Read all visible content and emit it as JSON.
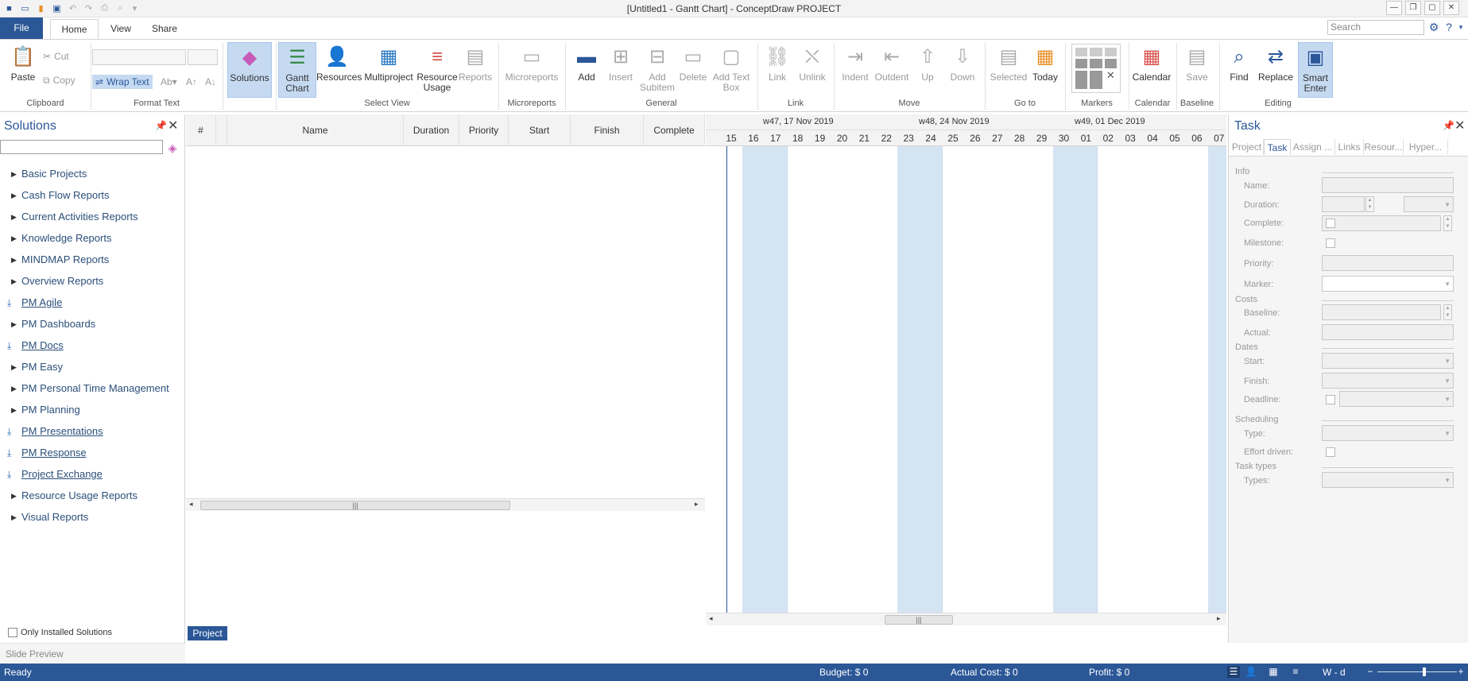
{
  "window": {
    "title": "[Untitled1 - Gantt Chart] - ConceptDraw PROJECT",
    "minimize": "▭",
    "restore": "▭",
    "close": "✕"
  },
  "ribbon_tabs": {
    "file": "File",
    "home": "Home",
    "view": "View",
    "share": "Share"
  },
  "search": {
    "placeholder": "Search"
  },
  "ribbon": {
    "clipboard": {
      "paste": "Paste",
      "cut": "Cut",
      "copy": "Copy",
      "group": "Clipboard"
    },
    "format_text": {
      "wrap_text": "Wrap Text",
      "group": "Format Text"
    },
    "select_view": {
      "solutions": "Solutions",
      "gantt": "Gantt\nChart",
      "resources": "Resources",
      "multiproject": "Multiproject",
      "resource_usage": "Resource\nUsage",
      "reports": "Reports",
      "group": "Select View"
    },
    "microreports": {
      "microreports": "Microreports",
      "group": "Microreports"
    },
    "general": {
      "add": "Add",
      "insert": "Insert",
      "add_subitem": "Add\nSubitem",
      "delete": "Delete",
      "add_text_box": "Add Text\nBox",
      "group": "General"
    },
    "link": {
      "link": "Link",
      "unlink": "Unlink",
      "group": "Link"
    },
    "move": {
      "indent": "Indent",
      "outdent": "Outdent",
      "up": "Up",
      "down": "Down",
      "group": "Move"
    },
    "goto": {
      "selected": "Selected",
      "today": "Today",
      "group": "Go to"
    },
    "markers": {
      "group": "Markers"
    },
    "calendar": {
      "calendar": "Calendar",
      "group": "Calendar"
    },
    "baseline": {
      "save": "Save",
      "group": "Baseline"
    },
    "editing": {
      "find": "Find",
      "replace": "Replace",
      "smart_enter": "Smart\nEnter",
      "group": "Editing"
    }
  },
  "solutions": {
    "title": "Solutions",
    "items": [
      {
        "label": "Basic Projects",
        "installed": false
      },
      {
        "label": "Cash Flow Reports",
        "installed": false
      },
      {
        "label": "Current Activities Reports",
        "installed": false
      },
      {
        "label": "Knowledge Reports",
        "installed": false
      },
      {
        "label": "MINDMAP Reports",
        "installed": false
      },
      {
        "label": "Overview Reports",
        "installed": false
      },
      {
        "label": "PM Agile",
        "installed": true
      },
      {
        "label": "PM Dashboards",
        "installed": false
      },
      {
        "label": "PM Docs",
        "installed": true
      },
      {
        "label": "PM Easy",
        "installed": false
      },
      {
        "label": "PM Personal Time Management",
        "installed": false
      },
      {
        "label": "PM Planning",
        "installed": false
      },
      {
        "label": "PM Presentations",
        "installed": true
      },
      {
        "label": "PM Response",
        "installed": true
      },
      {
        "label": "Project Exchange",
        "installed": true
      },
      {
        "label": "Resource Usage Reports",
        "installed": false
      },
      {
        "label": "Visual Reports",
        "installed": false
      }
    ],
    "only_installed": "Only Installed Solutions",
    "slide_preview": "Slide Preview"
  },
  "grid": {
    "columns": [
      "#",
      "",
      "Name",
      "Duration",
      "Priority",
      "Start",
      "Finish",
      "Complete"
    ]
  },
  "gantt": {
    "weeks": [
      "w47, 17 Nov 2019",
      "w48, 24 Nov 2019",
      "w49, 01 Dec 2019"
    ],
    "days": [
      "15",
      "16",
      "17",
      "18",
      "19",
      "20",
      "21",
      "22",
      "23",
      "24",
      "25",
      "26",
      "27",
      "28",
      "29",
      "30",
      "01",
      "02",
      "03",
      "04",
      "05",
      "06",
      "07"
    ]
  },
  "project_tab": "Project",
  "task_panel": {
    "title": "Task",
    "tabs": [
      "Project",
      "Task",
      "Assign ...",
      "Links",
      "Resour...",
      "Hyper..."
    ],
    "sections": {
      "info": "Info",
      "costs": "Costs",
      "dates": "Dates",
      "scheduling": "Scheduling",
      "task_types": "Task types"
    },
    "labels": {
      "name": "Name:",
      "duration": "Duration:",
      "complete": "Complete:",
      "milestone": "Milestone:",
      "priority": "Priority:",
      "marker": "Marker:",
      "baseline": "Baseline:",
      "actual": "Actual:",
      "start": "Start:",
      "finish": "Finish:",
      "deadline": "Deadline:",
      "type": "Type:",
      "effort_driven": "Effort driven:",
      "types": "Types:"
    }
  },
  "status": {
    "ready": "Ready",
    "budget": "Budget: $ 0",
    "actual_cost": "Actual Cost: $ 0",
    "profit": "Profit: $ 0",
    "zoom_unit": "W - d"
  },
  "colors": {
    "accent": "#2b5797",
    "weekend": "#d5e4f3",
    "active_button": "#c5daf1"
  }
}
